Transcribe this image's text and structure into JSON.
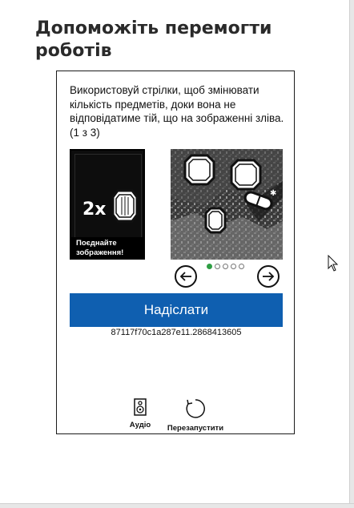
{
  "page": {
    "title": "Допоможіть перемогти роботів"
  },
  "captcha": {
    "instructions": "Використовуй стрілки, щоб змінювати кількість предметів, доки вона не відповідатиме тій, що на зображенні зліва. (1 з 3)",
    "example": {
      "count_text": "2x",
      "icon": "gem-icon",
      "caption": "Поєднайте зображення!"
    },
    "puzzle": {
      "icons": [
        "gem-icon",
        "gem-icon",
        "gem-icon",
        "pill-icon"
      ]
    },
    "pagination": {
      "total": 5,
      "active": 1
    },
    "controls": {
      "prev_icon": "arrow-left-icon",
      "next_icon": "arrow-right-icon"
    },
    "submit_label": "Надіслати",
    "session_id": "87117f70c1a287e11.2868413605",
    "audio_label": "Аудіо",
    "restart_label": "Перезапустити",
    "colors": {
      "primary": "#0f5fb0",
      "active_dot": "#2f9e44"
    }
  }
}
